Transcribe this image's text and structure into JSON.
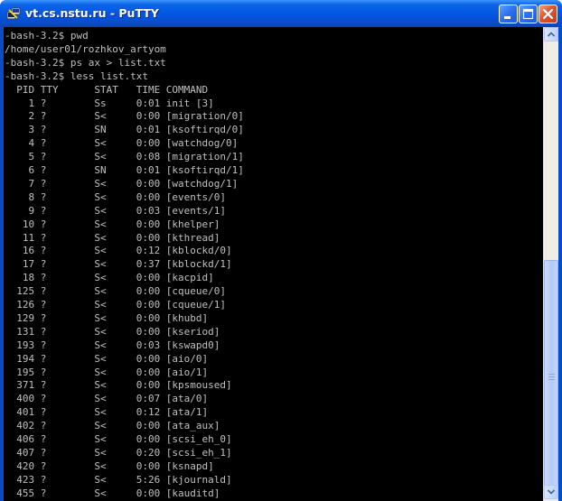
{
  "window": {
    "title": "vt.cs.nstu.ru - PuTTY",
    "buttons": [
      "minimize",
      "maximize",
      "close"
    ],
    "icon": "putty-icon"
  },
  "terminal": {
    "lines": [
      "-bash-3.2$ pwd",
      "/home/user01/rozhkov_artyom",
      "-bash-3.2$ ps ax > list.txt",
      "-bash-3.2$ less list.txt",
      "  PID TTY      STAT   TIME COMMAND",
      "    1 ?        Ss     0:01 init [3]",
      "    2 ?        S<     0:00 [migration/0]",
      "    3 ?        SN     0:01 [ksoftirqd/0]",
      "    4 ?        S<     0:00 [watchdog/0]",
      "    5 ?        S<     0:08 [migration/1]",
      "    6 ?        SN     0:01 [ksoftirqd/1]",
      "    7 ?        S<     0:00 [watchdog/1]",
      "    8 ?        S<     0:00 [events/0]",
      "    9 ?        S<     0:03 [events/1]",
      "   10 ?        S<     0:00 [khelper]",
      "   11 ?        S<     0:00 [kthread]",
      "   16 ?        S<     0:12 [kblockd/0]",
      "   17 ?        S<     0:37 [kblockd/1]",
      "   18 ?        S<     0:00 [kacpid]",
      "  125 ?        S<     0:00 [cqueue/0]",
      "  126 ?        S<     0:00 [cqueue/1]",
      "  129 ?        S<     0:00 [khubd]",
      "  131 ?        S<     0:00 [kseriod]",
      "  193 ?        S<     0:03 [kswapd0]",
      "  194 ?        S<     0:00 [aio/0]",
      "  195 ?        S<     0:00 [aio/1]",
      "  371 ?        S<     0:00 [kpsmoused]",
      "  400 ?        S<     0:07 [ata/0]",
      "  401 ?        S<     0:12 [ata/1]",
      "  402 ?        S<     0:00 [ata_aux]",
      "  406 ?        S<     0:00 [scsi_eh_0]",
      "  407 ?        S<     0:20 [scsi_eh_1]",
      "  420 ?        S<     0:00 [ksnapd]",
      "  423 ?        S<     5:26 [kjournald]",
      "  455 ?        S<     0:00 [kauditd]"
    ]
  },
  "colors": {
    "terminal_bg": "#000000",
    "terminal_fg": "#c0c0c0",
    "titlebar": "#0554e0",
    "close_button": "#e0552e"
  }
}
